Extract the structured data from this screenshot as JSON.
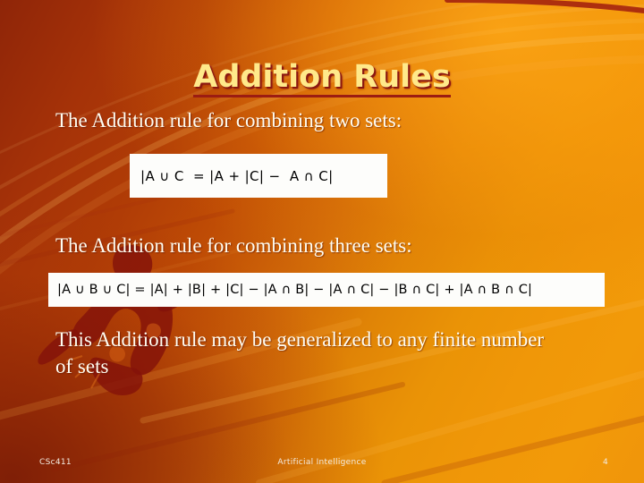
{
  "slide": {
    "title": "Addition Rules",
    "paragraphs": {
      "first": "The Addition rule for combining two sets:",
      "second": "The Addition rule for combining three sets:",
      "third": "This Addition rule may be generalized to any finite number of sets"
    },
    "formulas": {
      "two_sets": "|A ∪ C  = |A + |C| −  A ∩ C|",
      "three_sets": "|A ∪ B ∪ C| = |A| + |B| + |C| − |A ∩ B| − |A ∩ C| − |B ∩ C| + |A ∩ B ∩ C|"
    },
    "footer": {
      "course": "CSc411",
      "subject": "Artificial Intelligence",
      "page_number": "4"
    },
    "colors": {
      "title_text": "#ffe98a",
      "title_shadow": "#8c1710",
      "body_text": "#fffdf2",
      "background_bright": "#f29a09",
      "background_dark": "#8f2508",
      "formula_box": "#fdfdfb",
      "formula_text": "#000000",
      "footer_text": "#f3ece2"
    }
  }
}
